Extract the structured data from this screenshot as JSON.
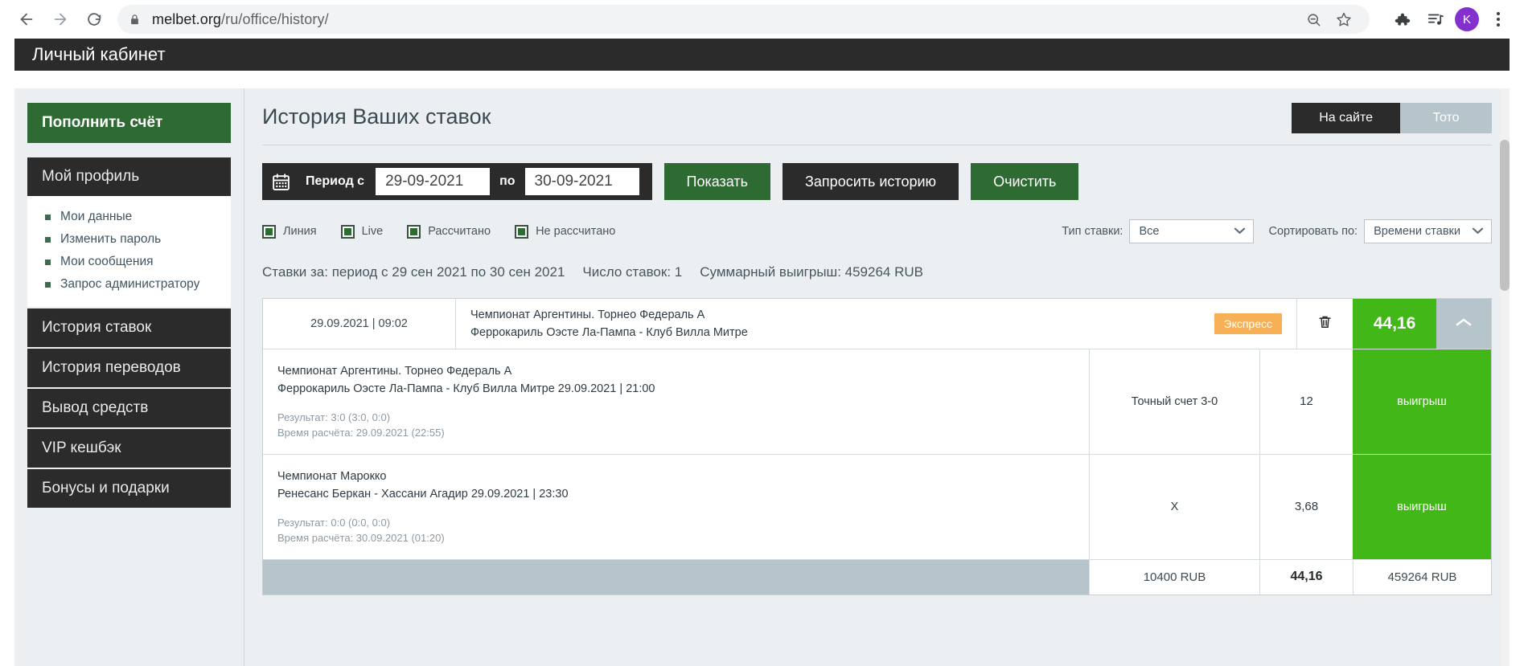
{
  "browser": {
    "url_domain": "melbet.org",
    "url_path": "/ru/office/history/",
    "back_icon": "back-arrow-icon",
    "forward_icon": "forward-arrow-icon",
    "reload_icon": "reload-icon",
    "lock_icon": "lock-icon",
    "search_icon": "search-icon",
    "bookmark_icon": "star-icon",
    "extensions_icon": "puzzle-icon",
    "media_icon": "playlist-music-icon",
    "avatar_letter": "K",
    "menu_icon": "kebab-menu-icon"
  },
  "site": {
    "header_title": "Личный кабинет"
  },
  "sidebar": {
    "deposit_button": "Пополнить счёт",
    "profile_section": "Мой профиль",
    "profile_items": [
      "Мои данные",
      "Изменить пароль",
      "Мои сообщения",
      "Запрос администратору"
    ],
    "links": [
      "История ставок",
      "История переводов",
      "Вывод средств",
      "VIP кешбэк",
      "Бонусы и подарки"
    ]
  },
  "main": {
    "page_title": "История Ваших ставок",
    "tabs": [
      {
        "label": "На сайте",
        "active": true
      },
      {
        "label": "Тото",
        "active": false
      }
    ],
    "filter": {
      "calendar_icon": "calendar-icon",
      "period_label": "Период с",
      "date_from": "29-09-2021",
      "between_label": "по",
      "date_to": "30-09-2021",
      "show_button": "Показать",
      "request_button": "Запросить историю",
      "clear_button": "Очистить"
    },
    "checkboxes": [
      {
        "label": "Линия",
        "checked": true
      },
      {
        "label": "Live",
        "checked": true
      },
      {
        "label": "Рассчитано",
        "checked": true
      },
      {
        "label": "Не рассчитано",
        "checked": true
      }
    ],
    "selects": [
      {
        "label": "Тип ставки:",
        "value": "Все"
      },
      {
        "label": "Сортировать по:",
        "value": "Времени ставки"
      }
    ],
    "summary": {
      "period": "Ставки за: период с 29 сен 2021 по 30 сен 2021",
      "count": "Число ставок: 1",
      "total_win": "Суммарный выигрыш: 459264 RUB"
    },
    "bet": {
      "datetime": "29.09.2021 | 09:02",
      "event_league": "Чемпионат Аргентины. Торнео Федераль А",
      "event_teams": "Феррокариль Оэсте Ла-Пампа - Клуб Вилла Митре",
      "badge": "Экспресс",
      "delete_icon": "trash-icon",
      "coefficient": "44,16",
      "collapse_icon": "chevron-up-icon",
      "rows": [
        {
          "league": "Чемпионат Аргентины. Торнео Федераль А",
          "teams": "Феррокариль Оэсте Ла-Пампа - Клуб Вилла Митре 29.09.2021 | 21:00",
          "result": "Результат: 3:0 (3:0, 0:0)",
          "calc_time": "Время расчёта: 29.09.2021 (22:55)",
          "pick": "Точный счет 3-0",
          "odd": "12",
          "status": "выигрыш"
        },
        {
          "league": "Чемпионат Марокко",
          "teams": "Ренесанс Беркан - Хассани Агадир 29.09.2021 | 23:30",
          "result": "Результат: 0:0 (0:0, 0:0)",
          "calc_time": "Время расчёта: 30.09.2021 (01:20)",
          "pick": "X",
          "odd": "3,68",
          "status": "выигрыш"
        }
      ],
      "footer": {
        "stake": "10400 RUB",
        "coefficient": "44,16",
        "win": "459264 RUB"
      }
    }
  },
  "colors": {
    "green_brand": "#2e6b33",
    "green_win": "#41b818",
    "dark": "#2b2b2b",
    "orange_badge": "#f7b055",
    "tab_inactive": "#b6c4cc"
  }
}
